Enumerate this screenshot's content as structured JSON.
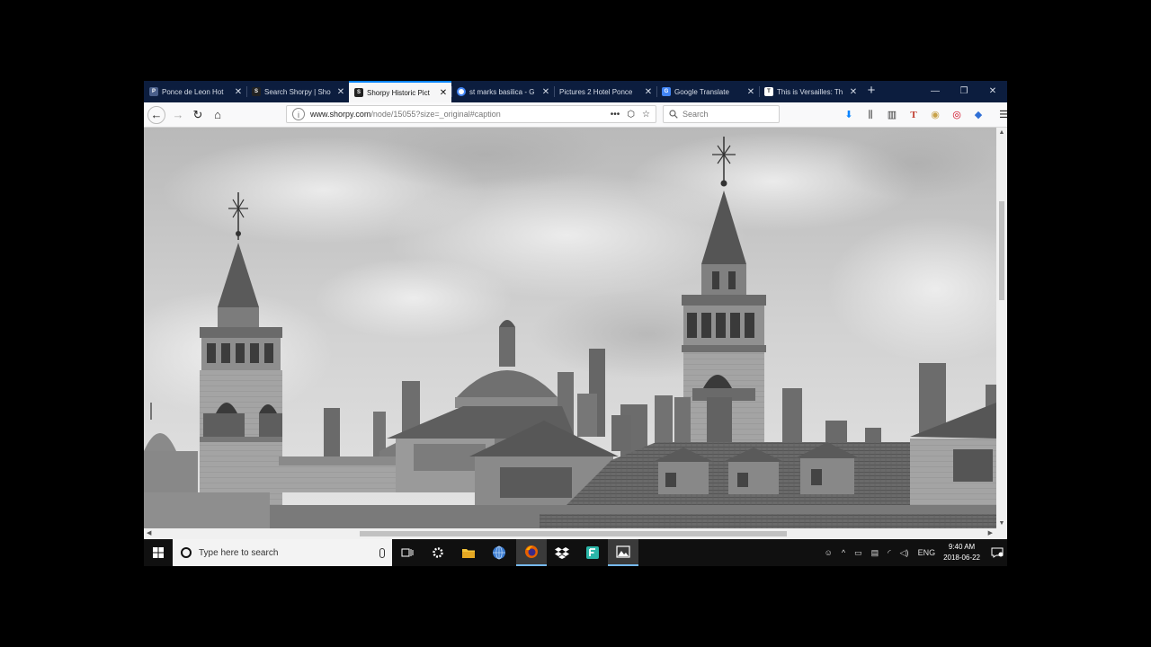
{
  "browser": {
    "tabs": [
      {
        "title": "Ponce de Leon Hot",
        "favicon_color": "#4a5f8a",
        "active": false
      },
      {
        "title": "Search Shorpy | Sho",
        "favicon_color": "#222222",
        "active": false
      },
      {
        "title": "Shorpy Historic Pict",
        "favicon_color": "#222222",
        "active": true
      },
      {
        "title": "st marks basilica - G",
        "favicon_color": "#4285f4",
        "active": false
      },
      {
        "title": "Pictures 2 Hotel Ponce",
        "favicon_color": "#0c1d3e",
        "active": false
      },
      {
        "title": "Google Translate",
        "favicon_color": "#4285f4",
        "active": false
      },
      {
        "title": "This is Versailles: Th",
        "favicon_color": "#333333",
        "active": false
      }
    ],
    "close_glyph": "✕",
    "new_tab_glyph": "+",
    "window_controls": {
      "minimize": "—",
      "restore": "❐",
      "close": "✕"
    },
    "nav": {
      "back": "←",
      "forward": "→",
      "reload": "↻",
      "home": "⌂"
    },
    "url": {
      "domain": "www.shorpy.com",
      "rest": "/node/15055?size=_original#caption"
    },
    "url_actions": {
      "more": "•••",
      "pocket": "⬡",
      "bookmark": "☆"
    },
    "search_placeholder": "Search",
    "toolbar_icons": {
      "download": "⬇",
      "library": "⫼",
      "sidebar": "▥",
      "ext1": "T",
      "ext2": "◉",
      "ext3": "◎",
      "ext4": "◆"
    },
    "menu": "☰"
  },
  "scroll": {
    "up": "▲",
    "down": "▼",
    "left": "◀",
    "right": "▶"
  },
  "taskbar": {
    "search_placeholder": "Type here to search",
    "clock_time": "9:40 AM",
    "clock_date": "2018-06-22",
    "language": "ENG"
  },
  "colors": {
    "titlebar": "#0c1d3e",
    "active_tab": "#f6f6f7",
    "accent": "#0a84ff",
    "taskbar": "#101010"
  }
}
